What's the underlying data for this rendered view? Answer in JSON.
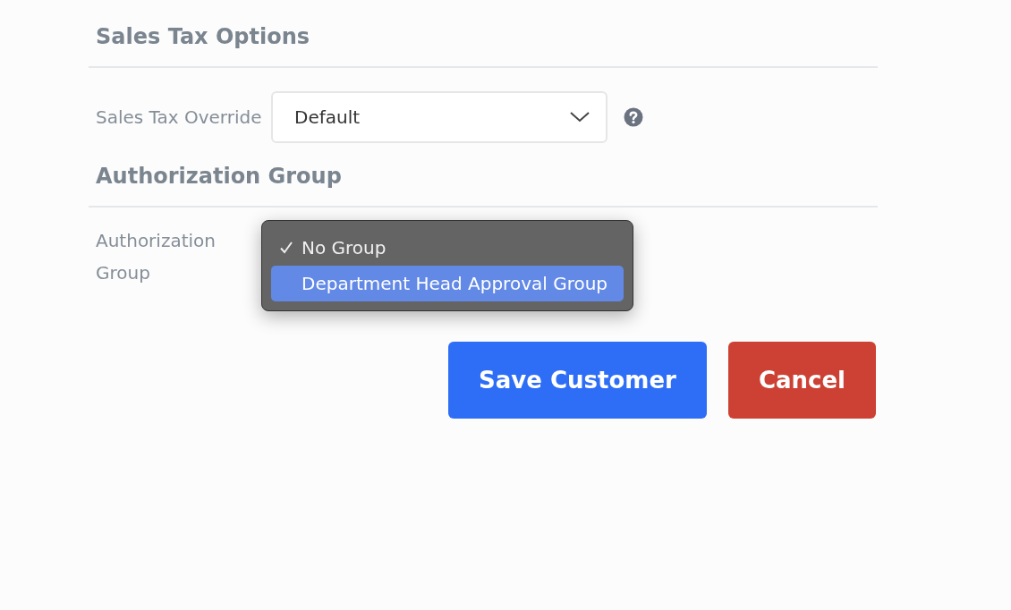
{
  "sections": [
    {
      "title": "Sales Tax Options",
      "field": {
        "kind": "select",
        "label": "Sales Tax Override",
        "value": "Default",
        "help": true
      }
    },
    {
      "title": "Authorization Group",
      "field": {
        "kind": "menu",
        "label": "Authorization Group",
        "options": [
          {
            "label": "No Group",
            "checked": true,
            "highlighted": false
          },
          {
            "label": "Department Head Approval Group",
            "checked": false,
            "highlighted": true
          }
        ]
      }
    }
  ],
  "buttons": [
    {
      "label": "Save Customer",
      "kind": "primary"
    },
    {
      "label": "Cancel",
      "kind": "danger"
    }
  ]
}
